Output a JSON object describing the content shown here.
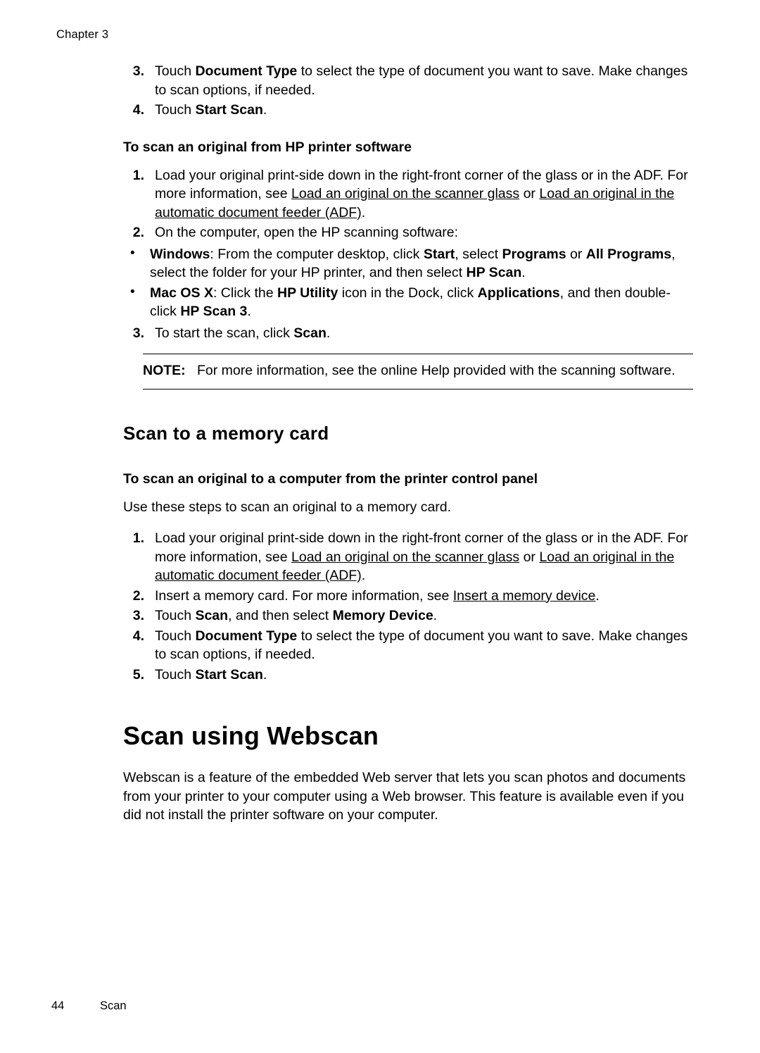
{
  "running_head": "Chapter 3",
  "footer": {
    "page_number": "44",
    "section": "Scan"
  },
  "top_steps": [
    {
      "num": "3.",
      "text_pre": "Touch ",
      "bold1": "Document Type",
      "text_post": " to select the type of document you want to save. Make changes to scan options, if needed."
    },
    {
      "num": "4.",
      "text_pre": "Touch ",
      "bold1": "Start Scan",
      "text_post": "."
    }
  ],
  "section_hp_software": {
    "heading": "To scan an original from HP printer software",
    "step1": {
      "num": "1.",
      "part1": "Load your original print-side down in the right-front corner of the glass or in the ADF. For more information, see ",
      "link1": "Load an original on the scanner glass",
      "mid": " or ",
      "link2": "Load an original in the automatic document feeder (ADF)",
      "part2": "."
    },
    "step2": {
      "num": "2.",
      "text": "On the computer, open the HP scanning software:"
    },
    "bullets": [
      {
        "bold1": "Windows",
        "t1": ": From the computer desktop, click ",
        "bold2": "Start",
        "t2": ", select ",
        "bold3": "Programs",
        "t3": " or ",
        "bold4": "All Programs",
        "t4": ", select the folder for your HP printer, and then select ",
        "bold5": "HP Scan",
        "t5": "."
      },
      {
        "bold1": "Mac OS X",
        "t1": ": Click the ",
        "bold2": "HP Utility",
        "t2": " icon in the Dock, click ",
        "bold3": "Applications",
        "t3": ", and then double-click ",
        "bold4": "HP Scan 3",
        "t4": "."
      }
    ],
    "step3": {
      "num": "3.",
      "pre": "To start the scan, click ",
      "bold": "Scan",
      "post": "."
    },
    "note": {
      "label": "NOTE:",
      "text": "For more information, see the online Help provided with the scanning software."
    }
  },
  "section_memory_card": {
    "title": "Scan to a memory card",
    "heading": "To scan an original to a computer from the printer control panel",
    "intro": "Use these steps to scan an original to a memory card.",
    "steps": [
      {
        "num": "1.",
        "part1": "Load your original print-side down in the right-front corner of the glass or in the ADF. For more information, see ",
        "link1": "Load an original on the scanner glass",
        "mid": " or ",
        "link2": "Load an original in the automatic document feeder (ADF)",
        "part2": "."
      },
      {
        "num": "2.",
        "part1": "Insert a memory card. For more information, see ",
        "link1": "Insert a memory device",
        "part2": "."
      },
      {
        "num": "3.",
        "pre": "Touch ",
        "bold1": "Scan",
        "mid": ", and then select ",
        "bold2": "Memory Device",
        "post": "."
      },
      {
        "num": "4.",
        "pre": "Touch ",
        "bold1": "Document Type",
        "post": " to select the type of document you want to save. Make changes to scan options, if needed."
      },
      {
        "num": "5.",
        "pre": "Touch ",
        "bold1": "Start Scan",
        "post": "."
      }
    ]
  },
  "section_webscan": {
    "title": "Scan using Webscan",
    "paragraph": "Webscan is a feature of the embedded Web server that lets you scan photos and documents from your printer to your computer using a Web browser. This feature is available even if you did not install the printer software on your computer."
  }
}
